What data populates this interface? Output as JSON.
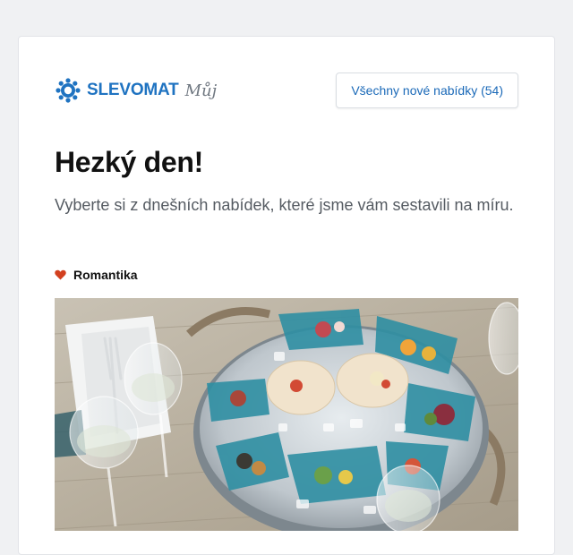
{
  "header": {
    "logo_text": "SLEVOMAT",
    "logo_subtext": "Můj",
    "all_offers_label": "Všechny nové nabídky (54)"
  },
  "main": {
    "greeting": "Hezký den!",
    "subtitle": "Vyberte si z dnešních nabídek, které jsme vám sestavili na míru."
  },
  "section": {
    "icon": "heart-icon",
    "label": "Romantika"
  },
  "colors": {
    "brand_blue": "#1f73c1",
    "heart_red": "#d2401f",
    "page_bg": "#f0f1f3"
  }
}
